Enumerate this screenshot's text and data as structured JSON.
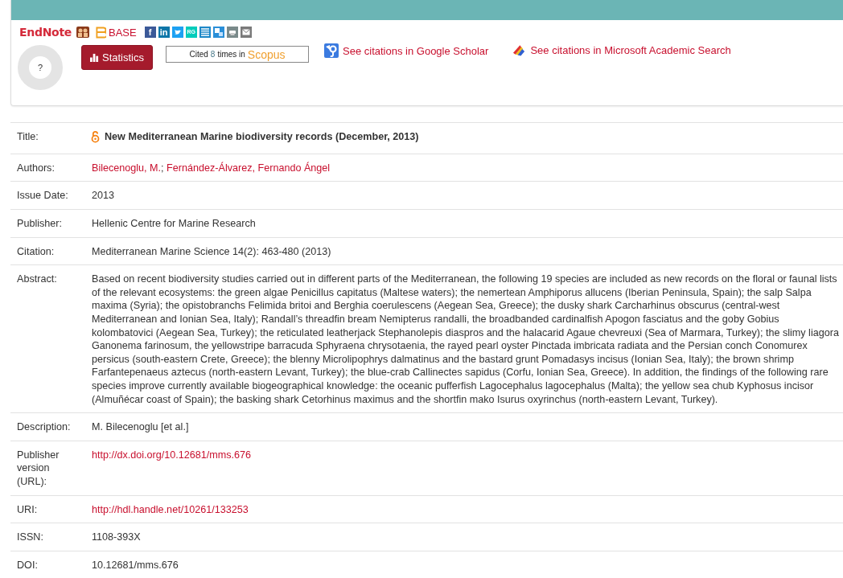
{
  "export": {
    "endnote": "EndNote",
    "base": "BASE"
  },
  "share_icons": [
    {
      "kind": "facebook",
      "label": "f",
      "color": "#3b5998"
    },
    {
      "kind": "linkedin",
      "label": "in",
      "color": "#0e76a8"
    },
    {
      "kind": "twitter",
      "color": "#1da1f2"
    },
    {
      "kind": "researchgate",
      "label": "RG",
      "color": "#00ccbb"
    },
    {
      "kind": "lines",
      "color": "#1e88c8"
    },
    {
      "kind": "squares",
      "color": "#2a8fd8"
    },
    {
      "kind": "print",
      "color": "#7a8a8a"
    },
    {
      "kind": "mail",
      "color": "#7a7a7a"
    }
  ],
  "altmetric": {
    "label": "?"
  },
  "statistics_button": "Statistics",
  "scopus": {
    "prefix": "Cited",
    "count": "8",
    "middle": "times in",
    "source": "Scopus"
  },
  "citation_links": [
    {
      "kind": "scholar",
      "label": "See citations in Google Scholar"
    },
    {
      "kind": "academic",
      "label": "See citations in Microsoft Academic Search"
    }
  ],
  "record": [
    {
      "kind": "title",
      "label": "Title:",
      "value": "New Mediterranean Marine biodiversity records (December, 2013)",
      "open_access": true
    },
    {
      "kind": "authors",
      "label": "Authors:",
      "authors": [
        "Bilecenoglu, M.",
        "Fernández-Álvarez, Fernando Ángel"
      ],
      "separator": ";"
    },
    {
      "kind": "text",
      "label": "Issue Date:",
      "value": "2013"
    },
    {
      "kind": "text",
      "label": "Publisher:",
      "value": "Hellenic Centre for Marine Research"
    },
    {
      "kind": "text",
      "label": "Citation:",
      "value": "Mediterranean Marine Science 14(2): 463-480 (2013)"
    },
    {
      "kind": "text",
      "label": "Abstract:",
      "value": "Based on recent biodiversity studies carried out in different parts of the Mediterranean, the following 19 species are included as new records on the floral or faunal lists of the relevant ecosystems: the green algae Penicillus capitatus (Maltese waters); the nemertean Amphiporus allucens (Iberian Peninsula, Spain); the salp Salpa maxima (Syria); the opistobranchs Felimida britoi and Berghia coerulescens (Aegean Sea, Greece); the dusky shark Carcharhinus obscurus (central-west Mediterranean and Ionian Sea, Italy); Randall’s threadfin bream Nemipterus randalli, the broadbanded cardinalfish Apogon fasciatus and the goby Gobius kolombatovici (Aegean Sea, Turkey); the reticulated leatherjack Stephanolepis diaspros and the halacarid Agaue chevreuxi (Sea of Marmara, Turkey); the slimy liagora Ganonema farinosum, the yellowstripe barracuda Sphyraena chrysotaenia, the rayed pearl oyster Pinctada imbricata radiata and the Persian conch Conomurex persicus (south-eastern Crete, Greece); the blenny Microlipophrys dalmatinus and the bastard grunt Pomadasys incisus (Ionian Sea, Italy); the brown shrimp Farfantepenaeus aztecus (north-eastern Levant, Turkey); the blue-crab Callinectes sapidus (Corfu, Ionian Sea, Greece). In addition, the findings of the following rare species improve currently available biogeographical knowledge: the oceanic pufferfish Lagocephalus lagocephalus (Malta); the yellow sea chub Kyphosus incisor (Almuñécar coast of Spain); the basking shark Cetorhinus maximus and the shortfin mako Isurus oxyrinchus (north-eastern Levant, Turkey)."
    },
    {
      "kind": "text",
      "label": "Description:",
      "value": "M. Bilecenoglu [et al.]"
    },
    {
      "kind": "link",
      "label": "Publisher version (URL):",
      "value": "http://dx.doi.org/10.12681/mms.676"
    },
    {
      "kind": "link",
      "label": "URI:",
      "value": "http://hdl.handle.net/10261/133253"
    },
    {
      "kind": "text",
      "label": "ISSN:",
      "value": "1108-393X"
    },
    {
      "kind": "text",
      "label": "DOI:",
      "value": "10.12681/mms.676"
    }
  ]
}
